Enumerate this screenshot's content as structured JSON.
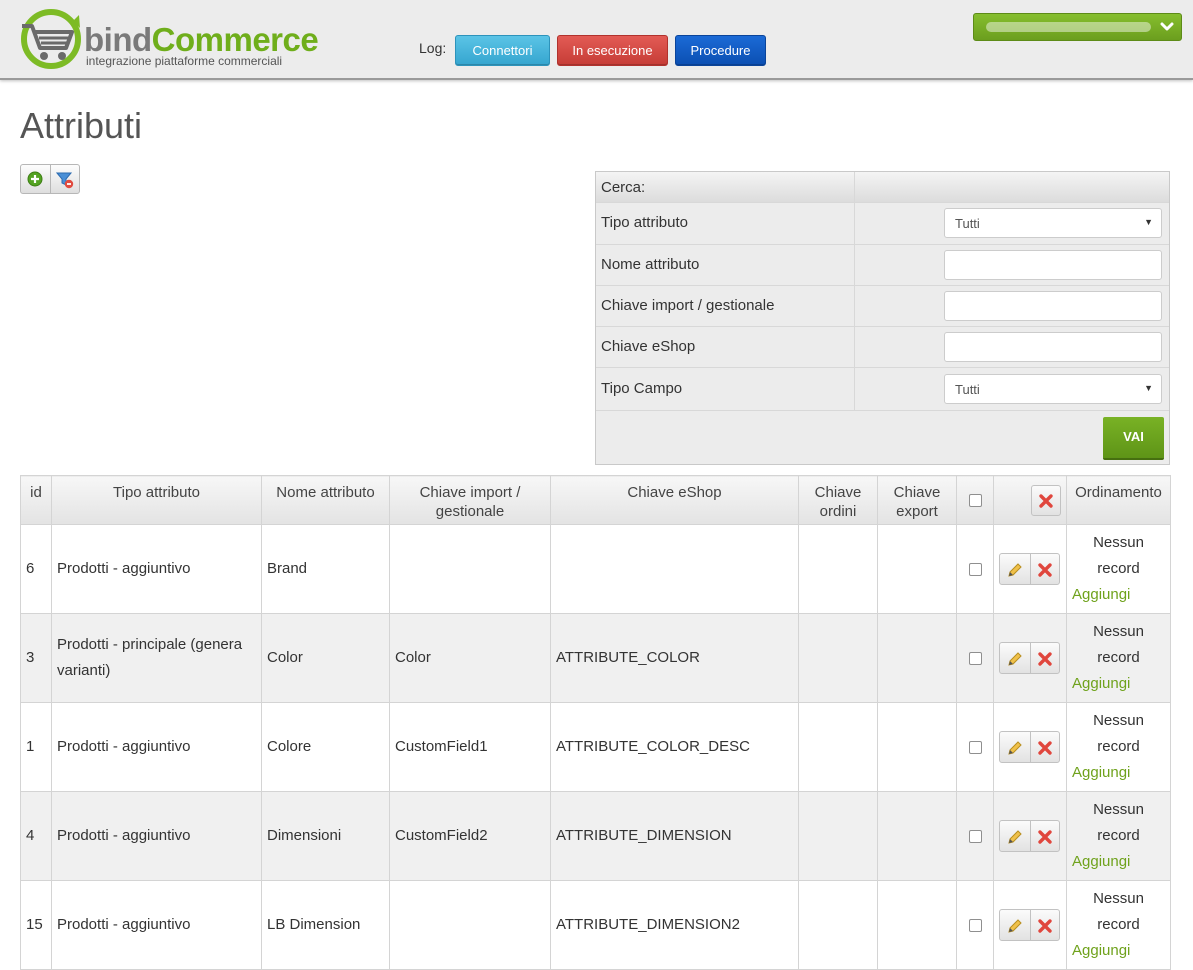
{
  "brand": {
    "name_part1": "bind",
    "name_part2": "Commerce",
    "tagline": "integrazione piattaforme commerciali",
    "accent_color": "#6fae1b"
  },
  "header": {
    "log_label": "Log:",
    "buttons": {
      "connettori": "Connettori",
      "in_esecuzione": "In esecuzione",
      "procedure": "Procedure"
    },
    "user_menu_icon": "chevron-down-icon"
  },
  "page": {
    "title": "Attributi"
  },
  "toolbar": {
    "add_icon": "plus-circle-icon",
    "clear_filter_icon": "filter-remove-icon"
  },
  "search": {
    "header": "Cerca:",
    "fields": {
      "tipo_attributo": {
        "label": "Tipo attributo",
        "value": "Tutti"
      },
      "nome_attributo": {
        "label": "Nome attributo",
        "value": ""
      },
      "chiave_import": {
        "label": "Chiave import / gestionale",
        "value": ""
      },
      "chiave_eshop": {
        "label": "Chiave eShop",
        "value": ""
      },
      "tipo_campo": {
        "label": "Tipo Campo",
        "value": "Tutti"
      }
    },
    "submit_label": "VAI"
  },
  "table": {
    "columns": {
      "id": "id",
      "tipo": "Tipo attributo",
      "nome": "Nome attributo",
      "chiave_import": "Chiave import / gestionale",
      "chiave_eshop": "Chiave eShop",
      "chiave_ordini": "Chiave ordini",
      "chiave_export": "Chiave export",
      "ordinamento": "Ordinamento"
    },
    "rows": [
      {
        "id": "6",
        "tipo": "Prodotti - aggiuntivo",
        "nome": "Brand",
        "chiave_import": "",
        "chiave_eshop": "",
        "chiave_ordini": "",
        "chiave_export": "",
        "ord_text": "Nessun record",
        "ord_link": "Aggiungi"
      },
      {
        "id": "3",
        "tipo": "Prodotti - principale (genera varianti)",
        "nome": "Color",
        "chiave_import": "Color",
        "chiave_eshop": "ATTRIBUTE_COLOR",
        "chiave_ordini": "",
        "chiave_export": "",
        "ord_text": "Nessun record",
        "ord_link": "Aggiungi"
      },
      {
        "id": "1",
        "tipo": "Prodotti - aggiuntivo",
        "nome": "Colore",
        "chiave_import": "CustomField1",
        "chiave_eshop": "ATTRIBUTE_COLOR_DESC",
        "chiave_ordini": "",
        "chiave_export": "",
        "ord_text": "Nessun record",
        "ord_link": "Aggiungi"
      },
      {
        "id": "4",
        "tipo": "Prodotti - aggiuntivo",
        "nome": "Dimensioni",
        "chiave_import": "CustomField2",
        "chiave_eshop": "ATTRIBUTE_DIMENSION",
        "chiave_ordini": "",
        "chiave_export": "",
        "ord_text": "Nessun record",
        "ord_link": "Aggiungi"
      },
      {
        "id": "15",
        "tipo": "Prodotti - aggiuntivo",
        "nome": "LB Dimension",
        "chiave_import": "",
        "chiave_eshop": "ATTRIBUTE_DIMENSION2",
        "chiave_ordini": "",
        "chiave_export": "",
        "ord_text": "Nessun record",
        "ord_link": "Aggiungi"
      }
    ]
  }
}
